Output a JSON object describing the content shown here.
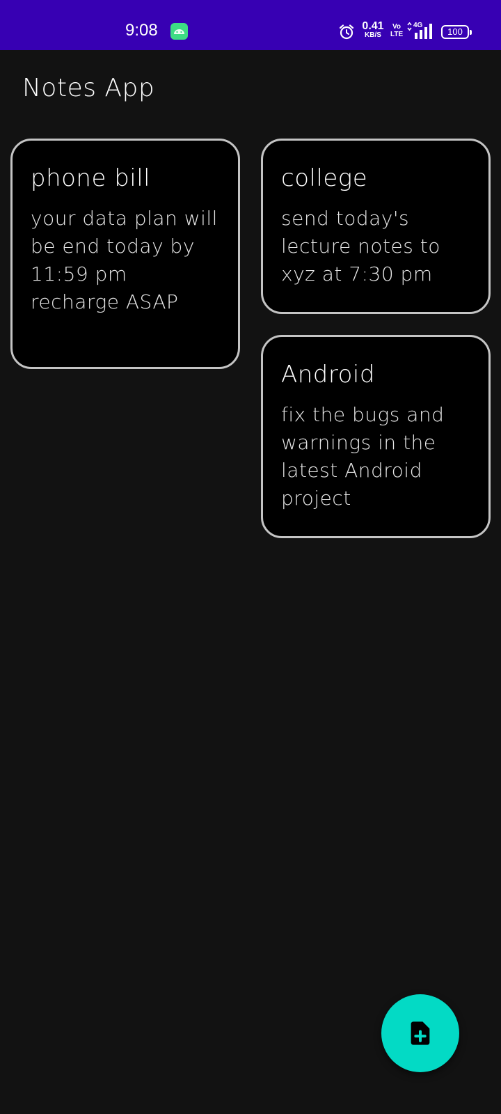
{
  "status_bar": {
    "time": "9:08",
    "app_icon": "android-icon",
    "alarm_icon": "alarm-icon",
    "net_speed_value": "0.41",
    "net_speed_unit": "KB/S",
    "volte_top": "Vo",
    "volte_bottom": "LTE",
    "network_type": "4G",
    "battery_level": "100",
    "bar_color": "#3700b3"
  },
  "header": {
    "title": "Notes App"
  },
  "notes": [
    {
      "title": "phone bill",
      "body": "your data plan will be end today by 11:59 pm recharge ASAP"
    },
    {
      "title": "college",
      "body": "send today's lecture notes to xyz at 7:30 pm"
    },
    {
      "title": "Android",
      "body": "fix the bugs and warnings in the latest Android project"
    }
  ],
  "fab": {
    "icon": "add-note-icon",
    "color": "#03dac5"
  },
  "colors": {
    "background": "#121212",
    "card_background": "#000000",
    "card_border": "#c4c4c4"
  }
}
